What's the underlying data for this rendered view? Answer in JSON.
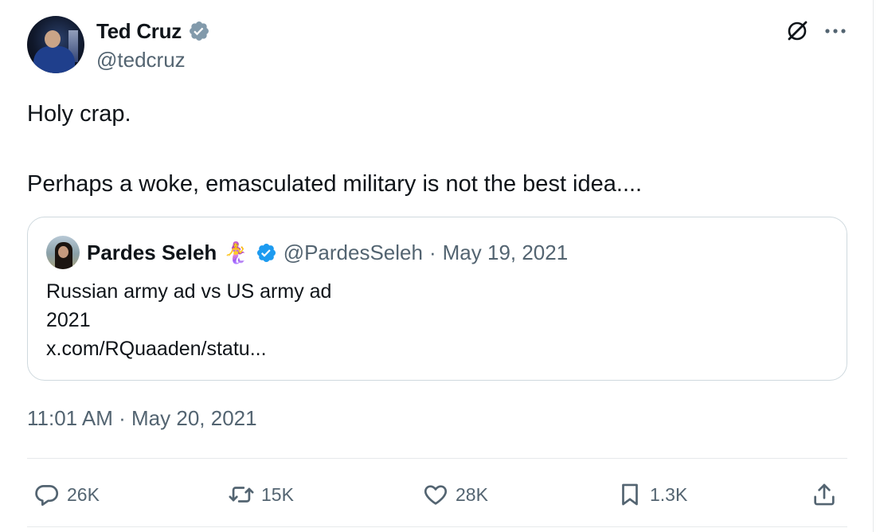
{
  "author": {
    "display_name": "Ted Cruz",
    "handle": "@tedcruz",
    "verified": true,
    "verified_color": "#829aab"
  },
  "tweet": {
    "line1": "Holy crap.",
    "line2": "Perhaps a woke, emasculated military is not the best idea...."
  },
  "quoted_tweet": {
    "display_name": "Pardes Seleh",
    "emoji": "🧜‍♀️",
    "verified_color": "#1d9bf0",
    "handle": "@PardesSeleh",
    "separator": "·",
    "date": "May 19, 2021",
    "lines": [
      "Russian army ad vs US army ad",
      "2021",
      "x.com/RQuaaden/statu..."
    ]
  },
  "timestamp": "11:01 AM · May 20, 2021",
  "actions": {
    "reply_count": "26K",
    "retweet_count": "15K",
    "like_count": "28K",
    "bookmark_count": "1.3K"
  },
  "icons": [
    "verified-badge-icon",
    "grok-icon",
    "more-icon",
    "reply-icon",
    "retweet-icon",
    "like-icon",
    "bookmark-icon",
    "share-icon"
  ]
}
